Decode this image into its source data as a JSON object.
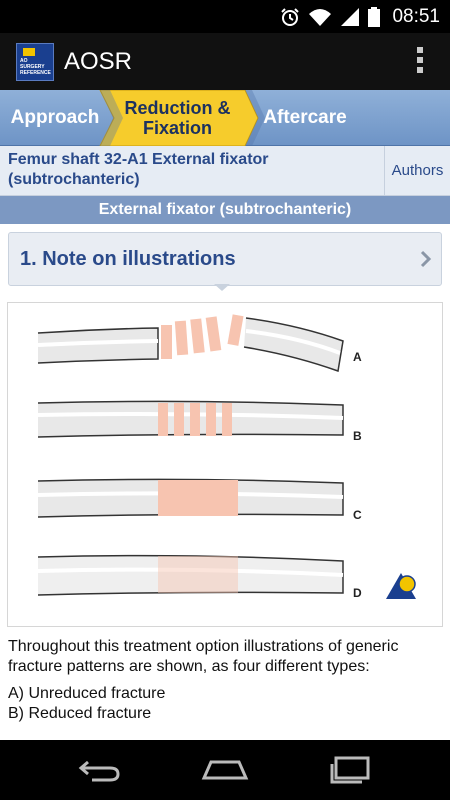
{
  "status_bar": {
    "time": "08:51",
    "icons": [
      "alarm-icon",
      "wifi-icon",
      "signal-icon",
      "battery-icon"
    ]
  },
  "app": {
    "name": "AOSR",
    "logo_text": [
      "AO",
      "SURGERY",
      "REFERENCE"
    ]
  },
  "tabs": [
    {
      "label": "Approach",
      "active": false
    },
    {
      "label": "Reduction & Fixation",
      "active": true
    },
    {
      "label": "Aftercare",
      "active": false
    }
  ],
  "page": {
    "title": "Femur shaft 32-A1 External fixator (subtrochanteric)",
    "authors_label": "Authors",
    "subheader": "External fixator (subtrochanteric)"
  },
  "step": {
    "label": "1. Note on illustrations"
  },
  "illustration": {
    "labels": [
      "A",
      "B",
      "C",
      "D"
    ]
  },
  "body": {
    "paragraph": "Throughout this treatment option illustrations of generic fracture patterns are shown, as four different types:",
    "items": [
      "A) Unreduced fracture",
      "B) Reduced fracture"
    ]
  },
  "colors": {
    "tab_bar": "#7a9ccb",
    "active_tab": "#f6cc2c",
    "title_text": "#2a4a8a",
    "fracture_highlight": "#f7c4b0"
  }
}
